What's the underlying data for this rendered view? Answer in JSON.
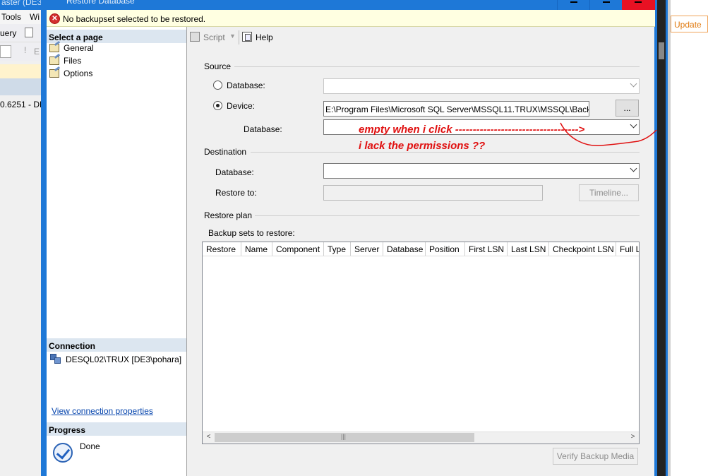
{
  "background_left": {
    "title": "aster (DE3",
    "menu": [
      "Tools",
      "Wi"
    ],
    "toolbar_text": "uery",
    "toolbar2_text": "E",
    "tree_item": "0.6251 - DE"
  },
  "background_right": {
    "update_label": "Update"
  },
  "dialog": {
    "title": "Restore Database",
    "error_message": "No backupset selected to be restored.",
    "left_pane": {
      "select_page_header": "Select a page",
      "pages": [
        {
          "label": "General"
        },
        {
          "label": "Files"
        },
        {
          "label": "Options"
        }
      ],
      "connection_header": "Connection",
      "connection_text": "DESQL02\\TRUX [DE3\\pohara]",
      "view_connection_link": "View connection properties",
      "progress_header": "Progress",
      "progress_status": "Done"
    },
    "toolbar": {
      "script_label": "Script",
      "help_label": "Help"
    },
    "source": {
      "section_title": "Source",
      "database_radio_label": "Database:",
      "device_radio_label": "Device:",
      "device_path": "E:\\Program Files\\Microsoft SQL Server\\MSSQL11.TRUX\\MSSQL\\Backup",
      "browse_button_label": "...",
      "device_database_label": "Database:",
      "selected_radio": "device"
    },
    "destination": {
      "section_title": "Destination",
      "database_label": "Database:",
      "restore_to_label": "Restore to:",
      "timeline_button_label": "Timeline..."
    },
    "restore_plan": {
      "section_title": "Restore plan",
      "backup_sets_label": "Backup sets to restore:",
      "columns": [
        "Restore",
        "Name",
        "Component",
        "Type",
        "Server",
        "Database",
        "Position",
        "First LSN",
        "Last LSN",
        "Checkpoint LSN",
        "Full LS"
      ],
      "rows": []
    },
    "verify_button_label": "Verify Backup Media"
  },
  "annotation": {
    "line1": "empty    when    i click ----------------------------------->",
    "line2": "i lack the permissions  ??",
    "color": "#e01010"
  }
}
